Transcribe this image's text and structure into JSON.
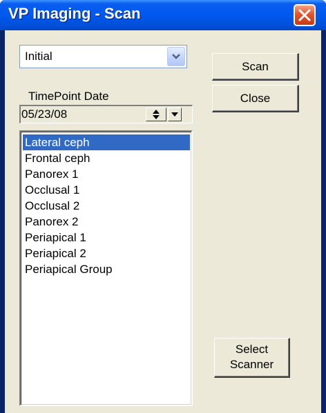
{
  "window": {
    "title": "VP Imaging - Scan"
  },
  "combo": {
    "selected": "Initial"
  },
  "timepoint": {
    "label": "TimePoint Date",
    "date": "05/23/08"
  },
  "list": {
    "items": [
      "Lateral ceph",
      "Frontal ceph",
      "Panorex 1",
      "Occlusal 1",
      "Occlusal 2",
      "Panorex 2",
      "Periapical 1",
      "Periapical 2",
      "Periapical Group"
    ],
    "selected_index": 0
  },
  "buttons": {
    "scan": "Scan",
    "close": "Close",
    "select_scanner_line1": "Select",
    "select_scanner_line2": "Scanner"
  },
  "colors": {
    "titlebar": "#0058ee",
    "selection": "#316ac5",
    "dialog_bg": "#ece9d8",
    "close_button": "#e2542d"
  }
}
